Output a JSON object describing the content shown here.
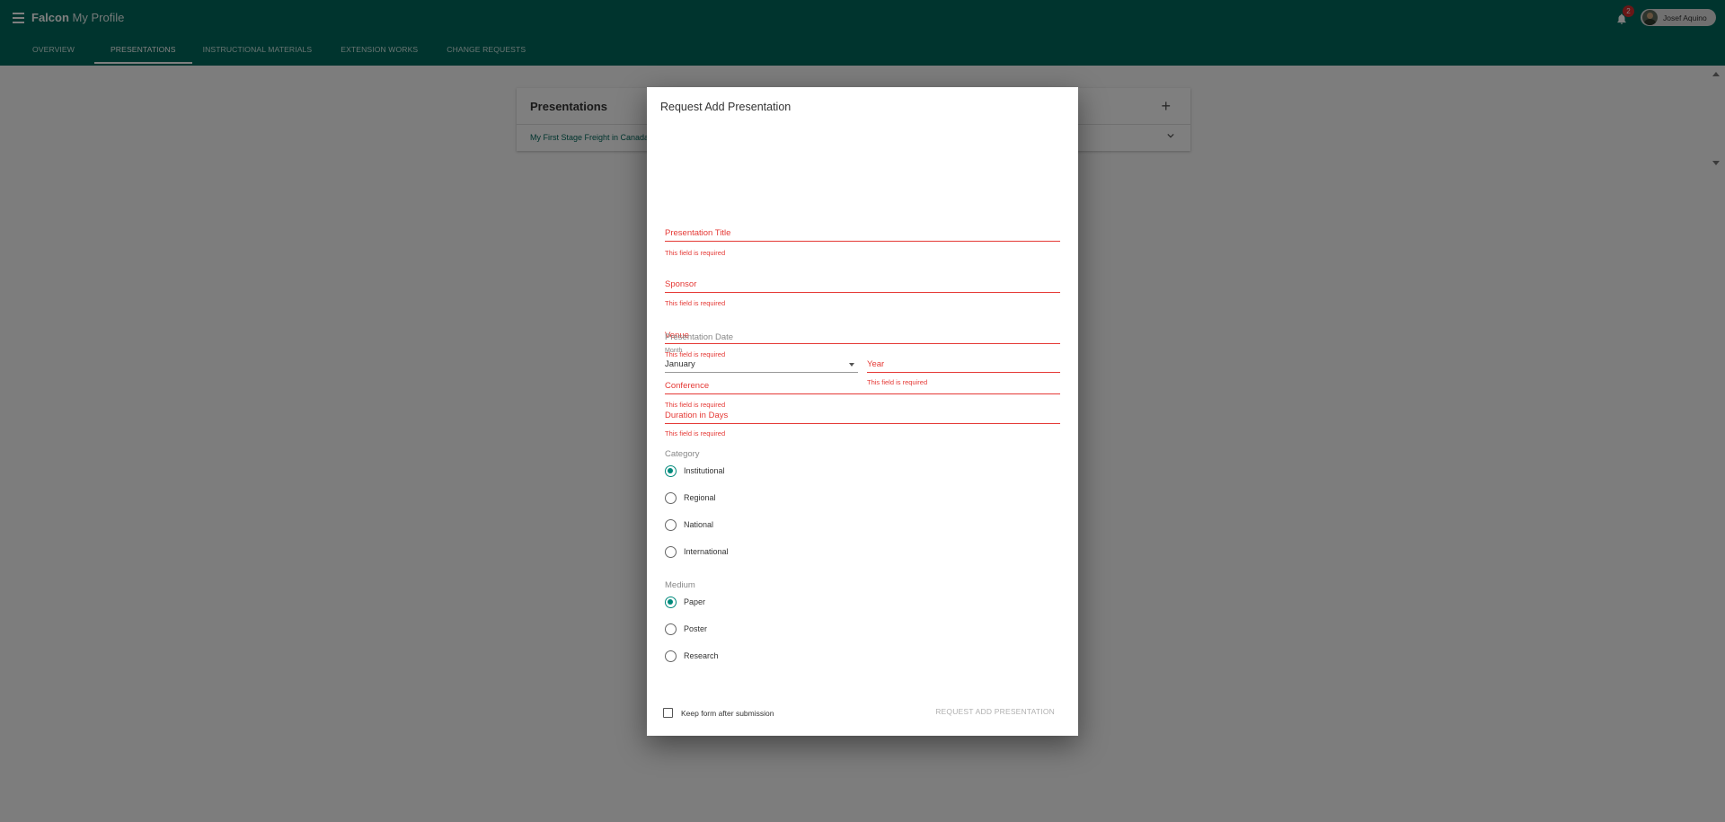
{
  "app": {
    "brand": "Falcon",
    "section_title": "My Profile",
    "menu_icon": "hamburger-menu-icon"
  },
  "nav": {
    "tabs": [
      {
        "label": "OVERVIEW",
        "active": false
      },
      {
        "label": "PRESENTATIONS",
        "active": true
      },
      {
        "label": "INSTRUCTIONAL MATERIALS",
        "active": false
      },
      {
        "label": "EXTENSION WORKS",
        "active": false
      },
      {
        "label": "CHANGE REQUESTS",
        "active": false
      }
    ]
  },
  "header": {
    "notification_count": "2",
    "user_name": "Josef Aquino",
    "notification_icon": "bell-icon"
  },
  "background_card": {
    "title": "Presentations",
    "add_icon": "plus-icon",
    "rows": [
      {
        "title": "My First Stage Freight in Canada"
      }
    ]
  },
  "dialog": {
    "title": "Request Add Presentation",
    "error_text": "This field is required",
    "fields": {
      "presentation_title": "Presentation Title",
      "sponsor": "Sponsor",
      "venue": "Venue",
      "conference": "Conference",
      "duration": "Duration in Days"
    },
    "presentation_date": {
      "label": "Presentation Date",
      "month_label": "Month",
      "month_value": "January",
      "year_label": "Year"
    },
    "category": {
      "label": "Category",
      "options": [
        "Institutional",
        "Regional",
        "National",
        "International"
      ],
      "selected": "Institutional"
    },
    "medium": {
      "label": "Medium",
      "options": [
        "Paper",
        "Poster",
        "Research"
      ],
      "selected": "Paper"
    },
    "keep_form_label": "Keep form after submission",
    "submit_label": "REQUEST ADD PRESENTATION"
  },
  "colors": {
    "primary": "#00695c",
    "accent": "#00897b",
    "error": "#e53935",
    "badge": "#d32f2f"
  }
}
